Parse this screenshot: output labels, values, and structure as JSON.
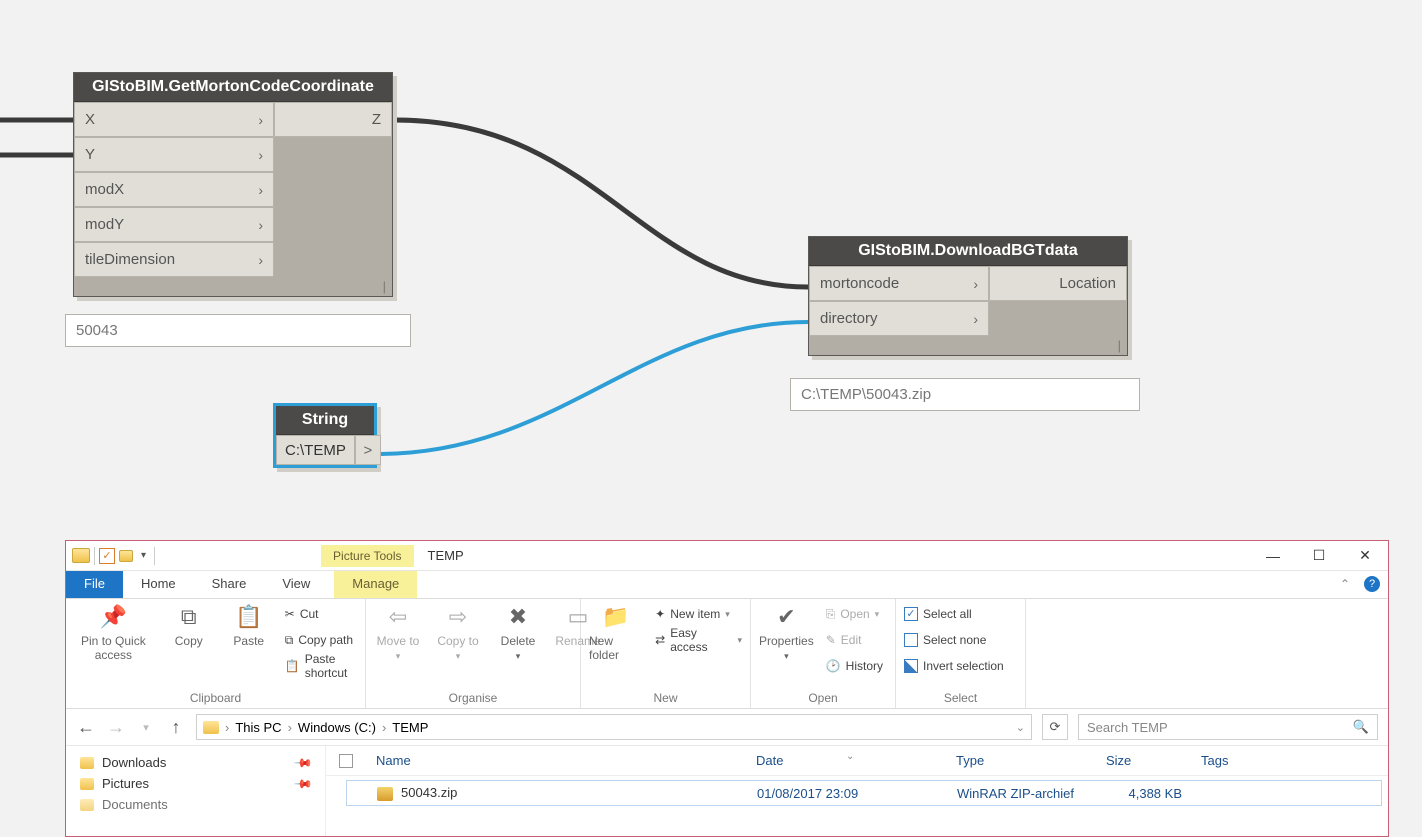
{
  "nodes": {
    "morton": {
      "title": "GIStoBIM.GetMortonCodeCoordinate",
      "inputs": [
        "X",
        "Y",
        "modX",
        "modY",
        "tileDimension"
      ],
      "output": "Z",
      "lacing": "|",
      "preview": "50043"
    },
    "string": {
      "title": "String",
      "value": "C:\\TEMP",
      "chev": ">"
    },
    "download": {
      "title": "GIStoBIM.DownloadBGTdata",
      "inputs": [
        "mortoncode",
        "directory"
      ],
      "output": "Location",
      "lacing": "|",
      "preview": "C:\\TEMP\\50043.zip"
    }
  },
  "explorer": {
    "contextTab": "Picture Tools",
    "title": "TEMP",
    "tabs": {
      "file": "File",
      "home": "Home",
      "share": "Share",
      "view": "View",
      "manage": "Manage"
    },
    "ribbon": {
      "clipboard": {
        "pin": "Pin to Quick access",
        "copy": "Copy",
        "paste": "Paste",
        "cut": "Cut",
        "copyPath": "Copy path",
        "pasteShortcut": "Paste shortcut",
        "label": "Clipboard"
      },
      "organise": {
        "moveTo": "Move to",
        "copyTo": "Copy to",
        "delete": "Delete",
        "rename": "Rename",
        "label": "Organise"
      },
      "new": {
        "newFolder": "New folder",
        "newItem": "New item",
        "easyAccess": "Easy access",
        "label": "New"
      },
      "open": {
        "properties": "Properties",
        "open": "Open",
        "edit": "Edit",
        "history": "History",
        "label": "Open"
      },
      "select": {
        "selectAll": "Select all",
        "selectNone": "Select none",
        "invert": "Invert selection",
        "label": "Select"
      }
    },
    "breadcrumb": {
      "thispc": "This PC",
      "drive": "Windows (C:)",
      "folder": "TEMP"
    },
    "searchPlaceholder": "Search TEMP",
    "columns": {
      "name": "Name",
      "date": "Date",
      "type": "Type",
      "size": "Size",
      "tags": "Tags"
    },
    "quickAccess": {
      "downloads": "Downloads",
      "pictures": "Pictures",
      "documents": "Documents"
    },
    "file": {
      "name": "50043.zip",
      "date": "01/08/2017 23:09",
      "type": "WinRAR ZIP-archief",
      "size": "4,388 KB"
    }
  }
}
